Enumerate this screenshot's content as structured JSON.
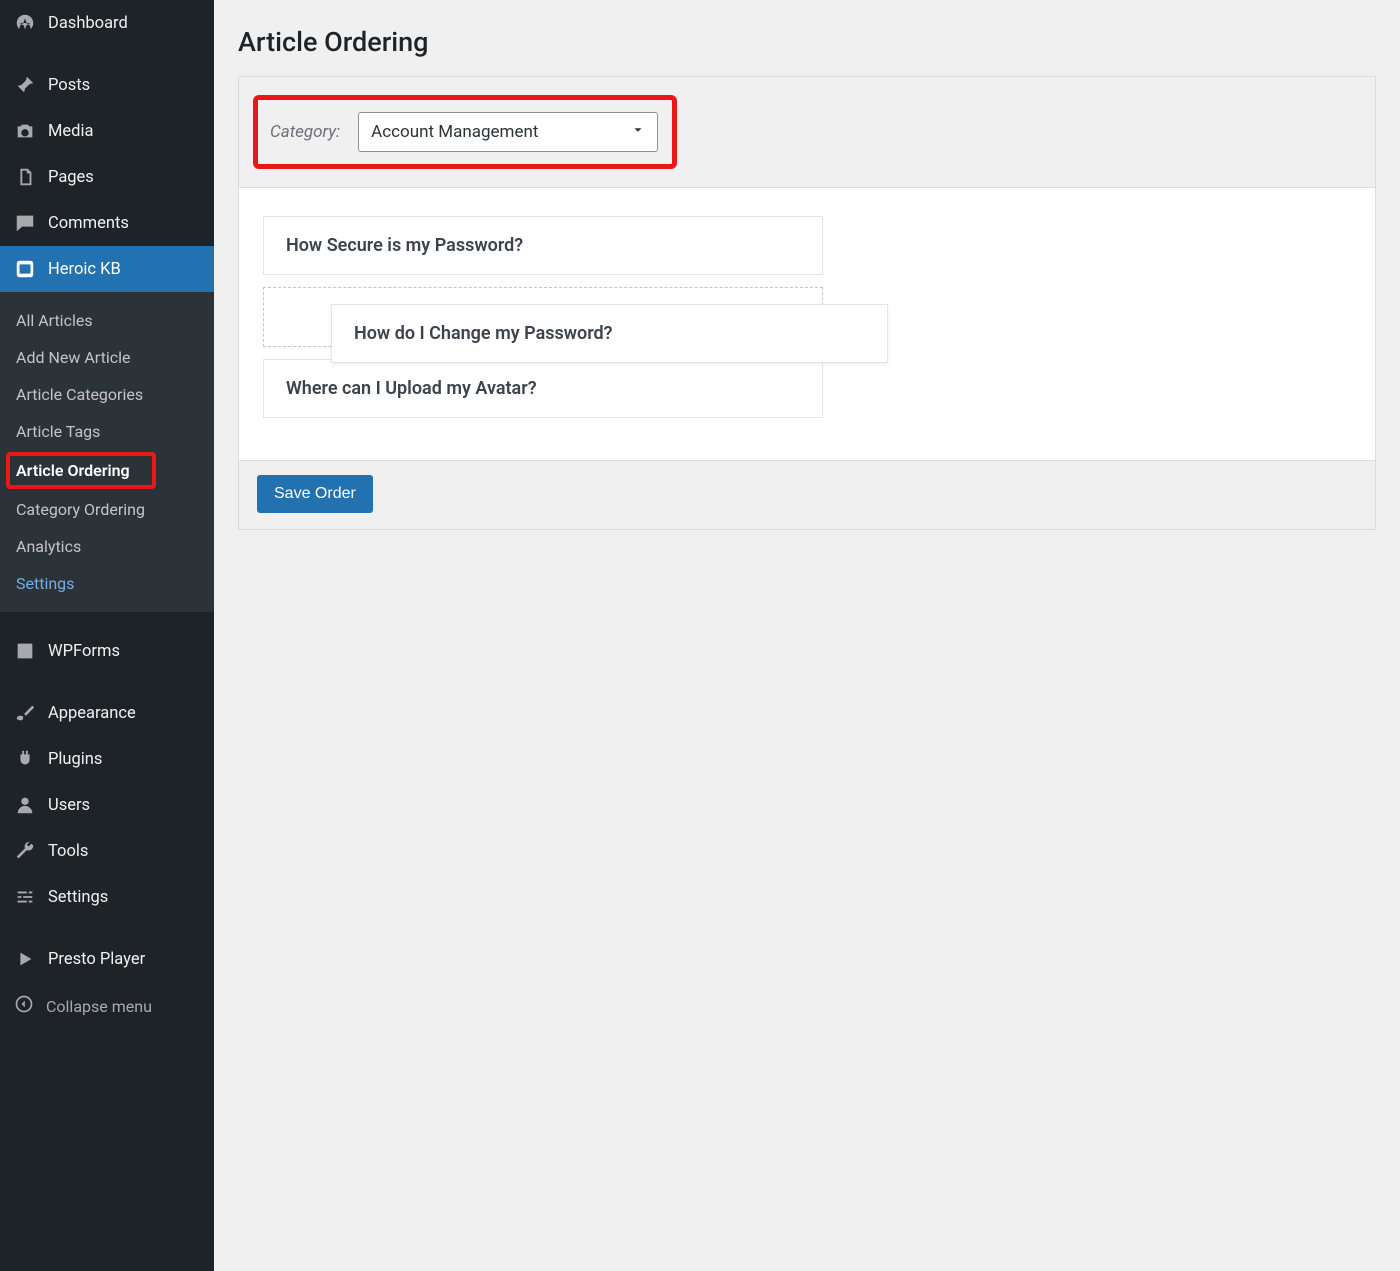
{
  "sidebar": {
    "dashboard": "Dashboard",
    "posts": "Posts",
    "media": "Media",
    "pages": "Pages",
    "comments": "Comments",
    "heroic_kb": "Heroic KB",
    "wpforms": "WPForms",
    "appearance": "Appearance",
    "plugins": "Plugins",
    "users": "Users",
    "tools": "Tools",
    "settings": "Settings",
    "presto": "Presto Player",
    "collapse": "Collapse menu"
  },
  "submenu": {
    "all_articles": "All Articles",
    "add_new": "Add New Article",
    "categories": "Article Categories",
    "tags": "Article Tags",
    "article_ordering": "Article Ordering",
    "category_ordering": "Category Ordering",
    "analytics": "Analytics",
    "settings": "Settings"
  },
  "page": {
    "title": "Article Ordering",
    "category_label": "Category:",
    "category_value": "Account Management",
    "save_label": "Save Order"
  },
  "articles": {
    "row1": "How Secure is my Password?",
    "row_dragging": "How do I Change my Password?",
    "row3": "Where can I Upload my Avatar?"
  }
}
